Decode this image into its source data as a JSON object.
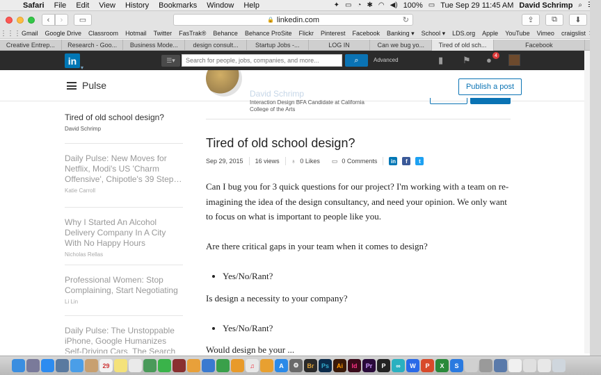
{
  "menubar": {
    "app": "Safari",
    "items": [
      "File",
      "Edit",
      "View",
      "History",
      "Bookmarks",
      "Window",
      "Help"
    ],
    "battery": "100%",
    "datetime": "Tue Sep 29  11:45 AM",
    "user": "David Schrimp"
  },
  "browser": {
    "url": "linkedin.com",
    "bookmarks": [
      "Gmail",
      "Google Drive",
      "Classroom",
      "Hotmail",
      "Twitter",
      "FasTrak®",
      "Behance",
      "Behance ProSite",
      "Flickr",
      "Pinterest",
      "Facebook",
      "Banking ▾",
      "School ▾",
      "LDS.org",
      "Apple",
      "YouTube",
      "Vimeo",
      "craigslist"
    ],
    "tabs": [
      "Creative Entrep...",
      "Research - Goo...",
      "Business Mode...",
      "design consult...",
      "Startup Jobs -...",
      "LOG IN",
      "Can we bug yo...",
      "Tired of old sch...",
      "Facebook"
    ],
    "active_tab_index": 7
  },
  "linkedin_nav": {
    "logo": "in",
    "search_placeholder": "Search for people, jobs, companies, and more...",
    "advanced_label": "Advanced",
    "notification_count": "4"
  },
  "pulse": {
    "title": "Pulse",
    "publish_label": "Publish a post",
    "author_name": "David Schrimp",
    "author_headline": "Interaction Design BFA Candidate at California College of the Arts"
  },
  "feed": [
    {
      "title": "Tired of old school design?",
      "author": "David Schrimp"
    },
    {
      "title": "Daily Pulse: New Moves for Netflix, Modi's US 'Charm Offensive', Chipotle's 39 Step…",
      "author": "Katie Carroll"
    },
    {
      "title": "Why I Started An Alcohol Delivery Company In A City With No Happy Hours",
      "author": "Nicholas Rellas"
    },
    {
      "title": "Professional Women: Stop Complaining, Start Negotiating",
      "author": "Li Lin"
    },
    {
      "title": "Daily Pulse: The Unstoppable iPhone, Google Humanizes Self-Driving Cars, The Search for…",
      "author": ""
    }
  ],
  "article": {
    "title": "Tired of old school design?",
    "date": "Sep 29, 2015",
    "views": "16 views",
    "likes": "0 Likes",
    "comments": "0 Comments",
    "paragraph1": "Can I bug you for 3 quick questions for our project? I'm working with a team on re-imagining the idea of the design consultancy, and need your opinion. We only want to focus on what is important to people like you.",
    "question1": "Are there critical gaps in your team when it comes to design?",
    "bullet1": "Yes/No/Rant?",
    "question2": "Is design a necessity to your company?",
    "bullet2": "Yes/No/Rant?",
    "question3": "Would design be your ..."
  },
  "colors": {
    "linkedin_blue": "#0077b5",
    "nav_bg": "#2b2b2b",
    "button_blue": "#0a73b4"
  }
}
